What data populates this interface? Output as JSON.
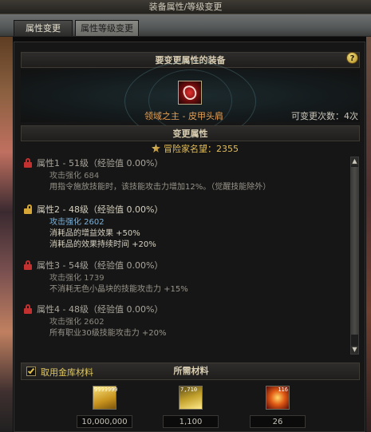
{
  "window": {
    "title": "装备属性/等级变更"
  },
  "tabs": [
    {
      "label": "属性变更",
      "active": true
    },
    {
      "label": "属性等级变更",
      "active": false
    }
  ],
  "equip_section": {
    "title": "要变更属性的装备",
    "item_name": "领域之主 - 皮甲头肩",
    "change_count": "可变更次数：4次",
    "help": "?"
  },
  "attr_section": {
    "title": "变更属性",
    "renown": "冒险家名望：2355",
    "attributes": [
      {
        "title": "属性1 - 51级（经验值 0.00%）",
        "locked": true,
        "lines": [
          "攻击强化 684",
          "用指令施放技能时，该技能攻击力增加12%。（觉醒技能除外）"
        ]
      },
      {
        "title": "属性2 - 48级（经验值 0.00%）",
        "locked": false,
        "lines": [
          "攻击强化 2602",
          "消耗品的增益效果 +50%",
          "消耗品的效果持续时间 +20%"
        ]
      },
      {
        "title": "属性3 - 54级（经验值 0.00%）",
        "locked": true,
        "lines": [
          "攻击强化 1739",
          "不消耗无色小晶块的技能攻击力 +15%"
        ]
      },
      {
        "title": "属性4 - 48级（经验值 0.00%）",
        "locked": true,
        "lines": [
          "攻击强化 2602",
          "所有职业30级技能攻击力 +20%"
        ]
      }
    ]
  },
  "materials": {
    "title": "所需材料",
    "checkbox_label": "取用金库材料",
    "checkbox_checked": true,
    "items": [
      {
        "icon": "gold-coins-icon",
        "count_label": "9999999",
        "value": "10,000,000"
      },
      {
        "icon": "yellow-gem-icon",
        "count_label": "7,710",
        "value": "1,100"
      },
      {
        "icon": "ember-icon",
        "count_label": "116",
        "value": "26"
      }
    ]
  },
  "colors": {
    "item_name": "#e8a052",
    "renown": "#e2bd5a",
    "locked": "#c23030",
    "unlocked": "#d6a636",
    "active_value": "#7ab0d8"
  }
}
